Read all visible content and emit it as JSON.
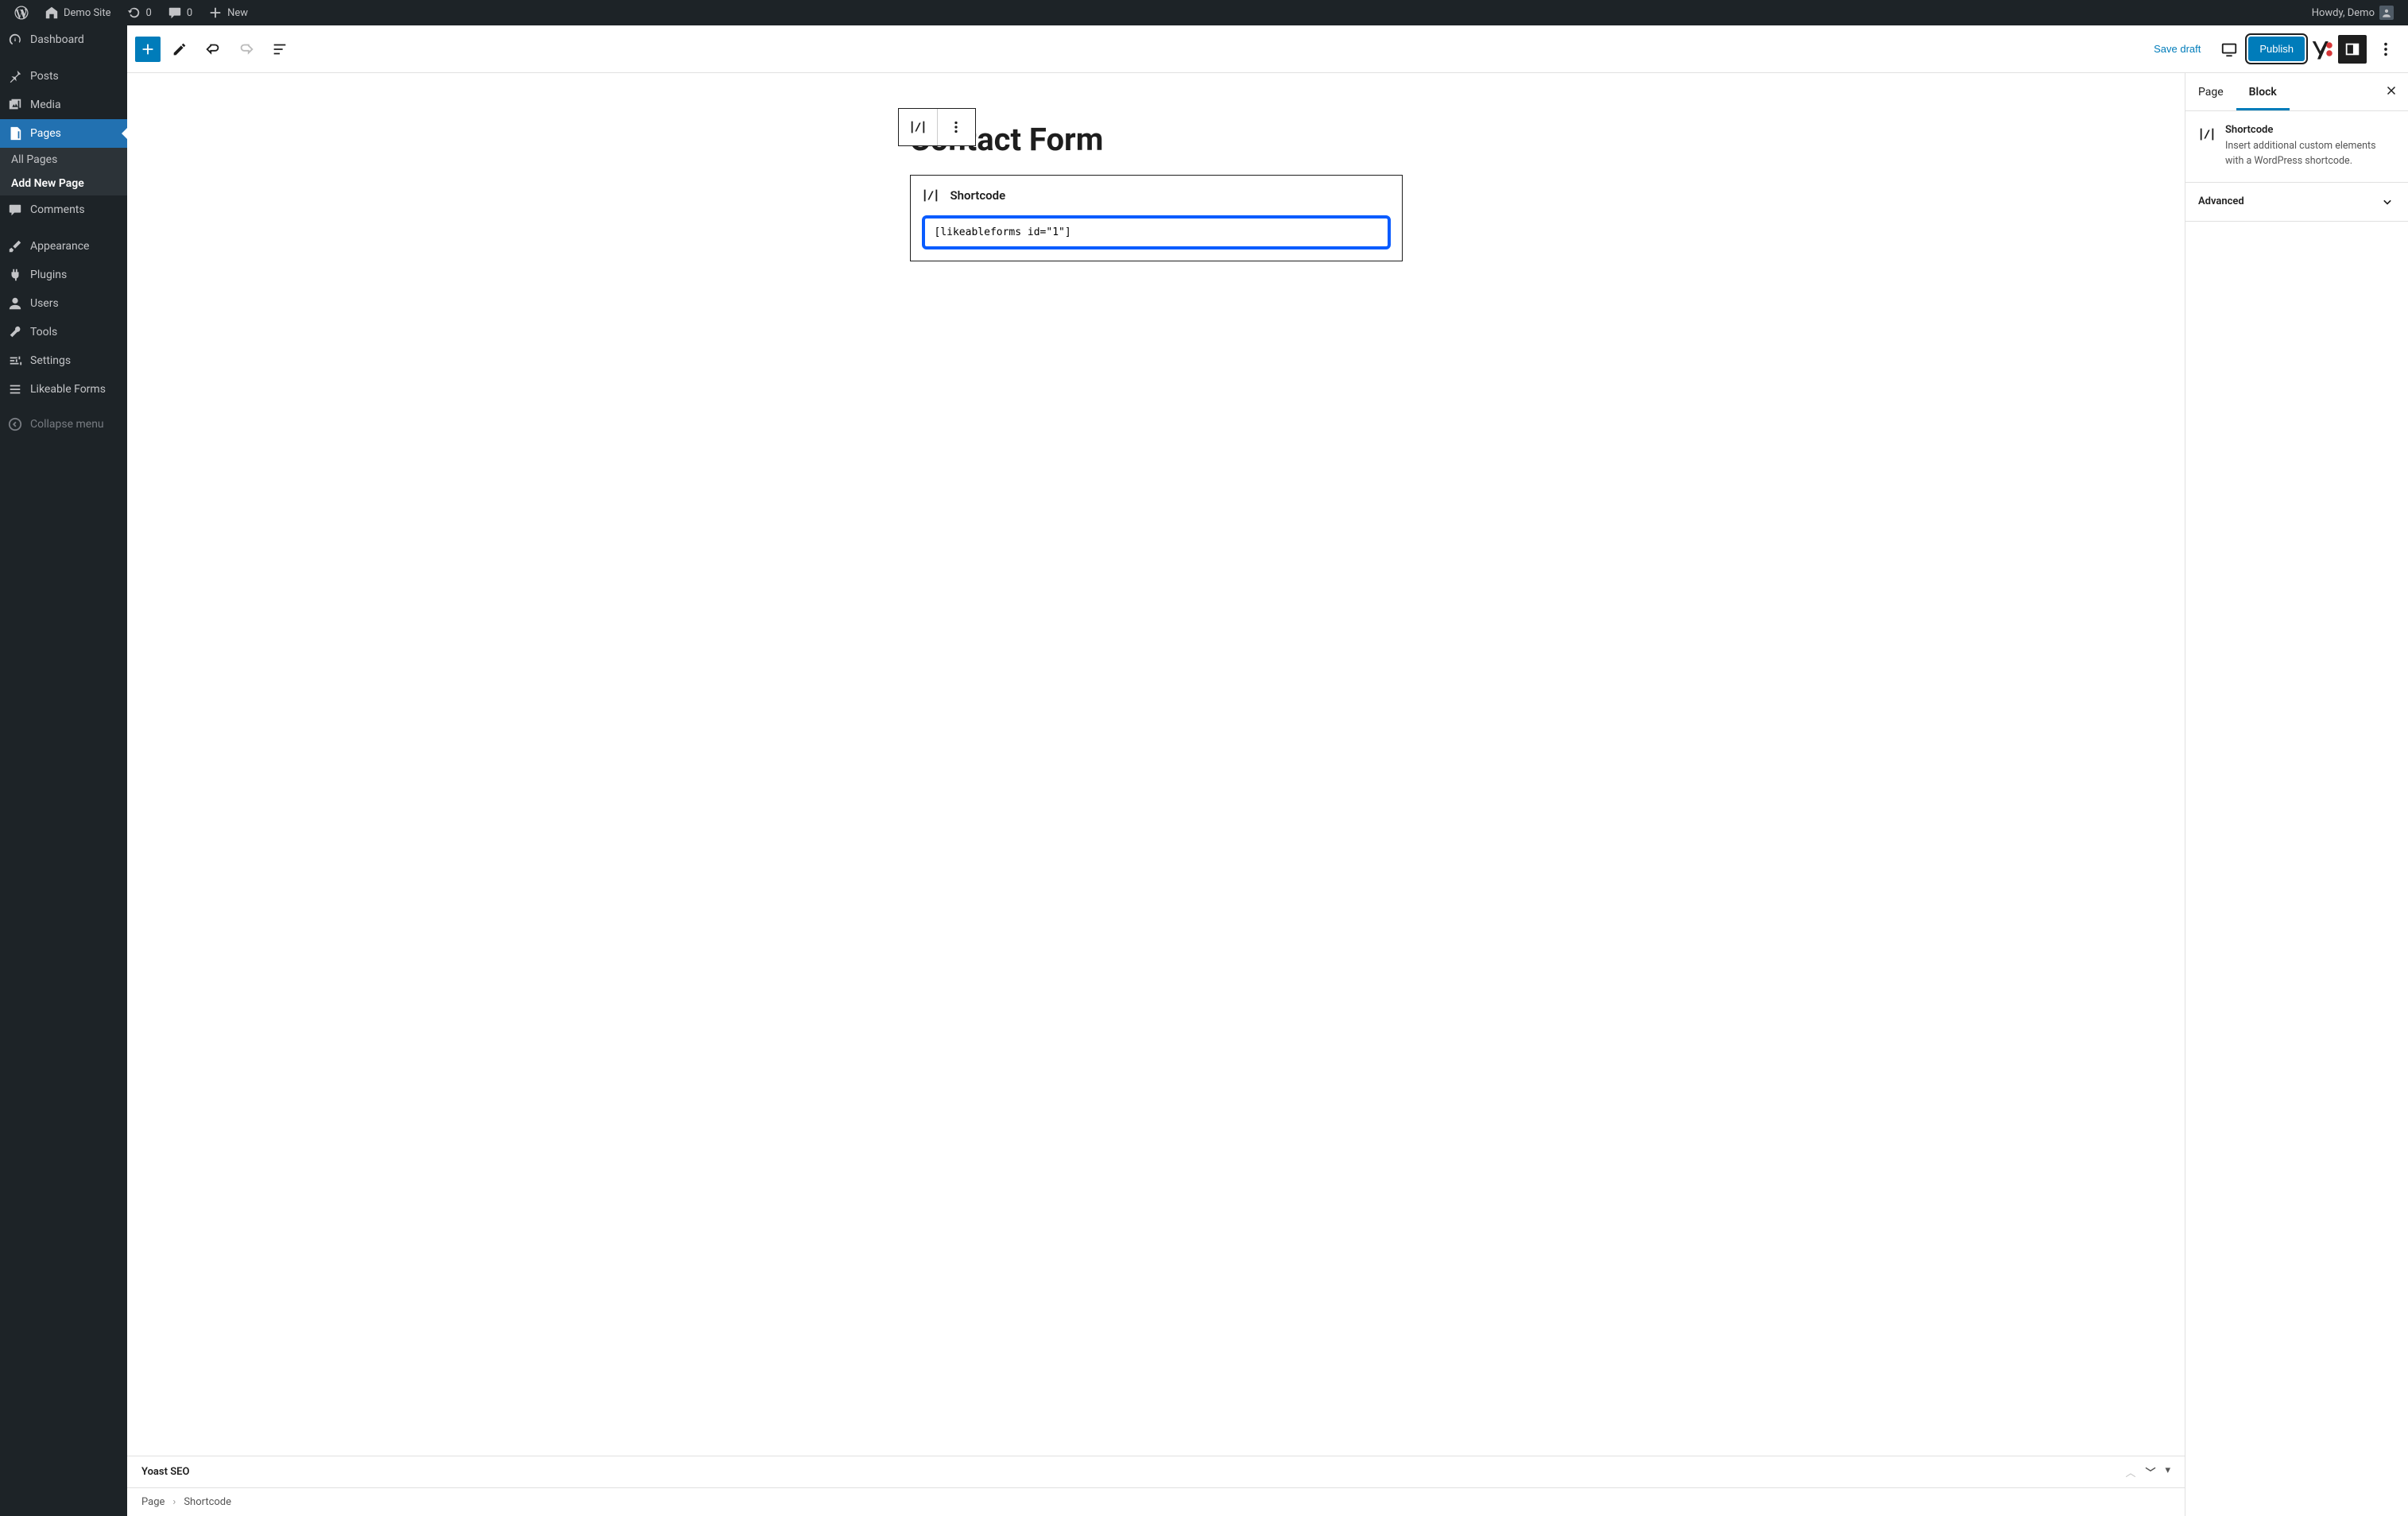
{
  "adminbar": {
    "site_name": "Demo Site",
    "refresh_count": "0",
    "comments_count": "0",
    "new_label": "New",
    "howdy": "Howdy, Demo"
  },
  "adminmenu": {
    "items": [
      {
        "icon": "dashboard",
        "label": "Dashboard"
      },
      {
        "icon": "pin",
        "label": "Posts"
      },
      {
        "icon": "media",
        "label": "Media"
      },
      {
        "icon": "pages",
        "label": "Pages",
        "active": true,
        "submenu": [
          "All Pages",
          "Add New Page"
        ],
        "submenu_current": 1
      },
      {
        "icon": "comments",
        "label": "Comments"
      },
      {
        "icon": "appearance",
        "label": "Appearance"
      },
      {
        "icon": "plugins",
        "label": "Plugins"
      },
      {
        "icon": "users",
        "label": "Users"
      },
      {
        "icon": "tools",
        "label": "Tools"
      },
      {
        "icon": "settings",
        "label": "Settings"
      },
      {
        "icon": "list",
        "label": "Likeable Forms"
      }
    ],
    "collapse": "Collapse menu"
  },
  "editor_header": {
    "save_draft": "Save draft",
    "publish": "Publish"
  },
  "post": {
    "title": "Contact Form"
  },
  "shortcode_block": {
    "label": "Shortcode",
    "value": "[likeableforms id=\"1\"]"
  },
  "bottom": {
    "yoast_label": "Yoast SEO",
    "breadcrumb_root": "Page",
    "breadcrumb_current": "Shortcode"
  },
  "settings": {
    "tab_page": "Page",
    "tab_block": "Block",
    "block_name": "Shortcode",
    "block_desc": "Insert additional custom elements with a WordPress shortcode.",
    "advanced": "Advanced"
  }
}
